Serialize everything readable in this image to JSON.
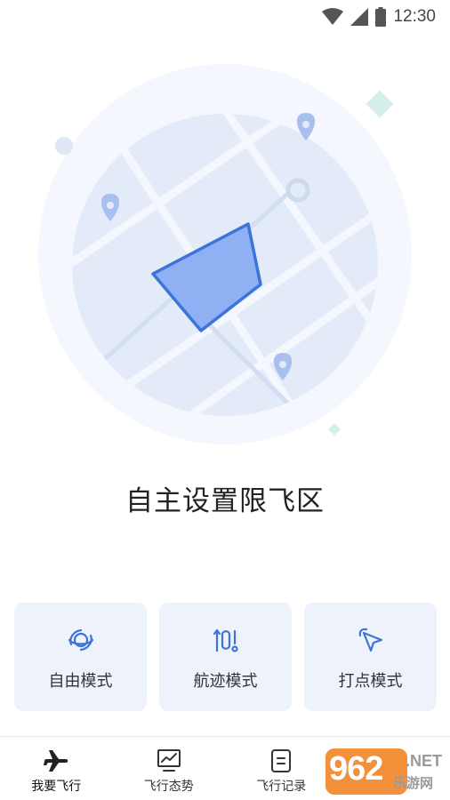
{
  "status_bar": {
    "time": "12:30",
    "icons": [
      "wifi-icon",
      "cellular-signal-icon",
      "battery-icon"
    ]
  },
  "illustration": {
    "description_icons": [
      "map-pin-icon",
      "no-fly-zone-polygon"
    ]
  },
  "headline": "自主设置限飞区",
  "modes": [
    {
      "label": "自由模式",
      "icon": "orbit-icon"
    },
    {
      "label": "航迹模式",
      "icon": "route-icon"
    },
    {
      "label": "打点模式",
      "icon": "pointer-icon"
    }
  ],
  "nav": [
    {
      "label": "我要飞行",
      "icon": "airplane-icon",
      "active": true
    },
    {
      "label": "飞行态势",
      "icon": "trend-chart-icon",
      "active": false
    },
    {
      "label": "飞行记录",
      "icon": "document-icon",
      "active": false
    },
    {
      "label": "",
      "icon": "profile-icon",
      "active": false
    }
  ],
  "watermark": {
    "number": "962",
    "suffix": ".NET",
    "text": "乐游网"
  },
  "colors": {
    "accent": "#3d74d9",
    "card_bg": "#eef3fb",
    "map_bg": "#e3ebf9"
  }
}
